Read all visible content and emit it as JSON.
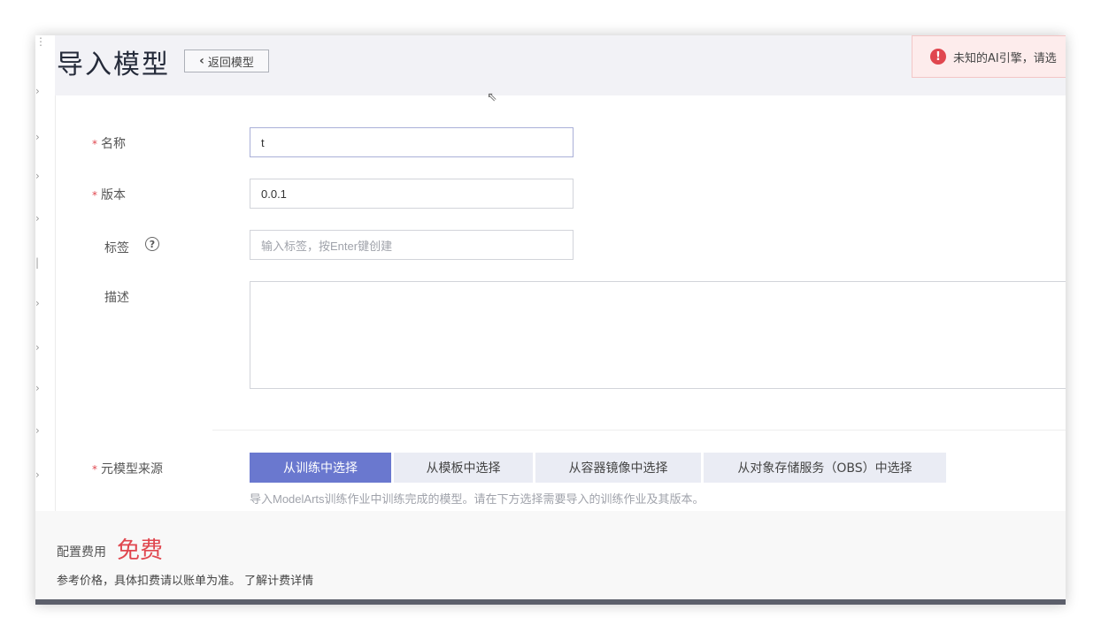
{
  "page": {
    "title": "导入模型",
    "back_label": "返回模型"
  },
  "alert": {
    "text": "未知的AI引擎，请选"
  },
  "form": {
    "name": {
      "label": "名称",
      "value": "t"
    },
    "version": {
      "label": "版本",
      "value": "0.0.1"
    },
    "tags": {
      "label": "标签",
      "placeholder": "输入标签，按Enter键创建"
    },
    "description": {
      "label": "描述",
      "value": ""
    },
    "source": {
      "label": "元模型来源",
      "tabs": [
        {
          "label": "从训练中选择"
        },
        {
          "label": "从模板中选择"
        },
        {
          "label": "从容器镜像中选择"
        },
        {
          "label": "从对象存储服务（OBS）中选择"
        }
      ],
      "active_index": 0,
      "hint": "导入ModelArts训练作业中训练完成的模型。请在下方选择需要导入的训练作业及其版本。"
    }
  },
  "footer": {
    "fee_label": "配置费用",
    "fee_value": "免费",
    "note": "参考价格，具体扣费请以账单为准。",
    "link": "了解计费详情"
  },
  "colors": {
    "accent": "#6a78cf",
    "danger": "#e0474f",
    "header_bg": "#f2f2f6"
  }
}
